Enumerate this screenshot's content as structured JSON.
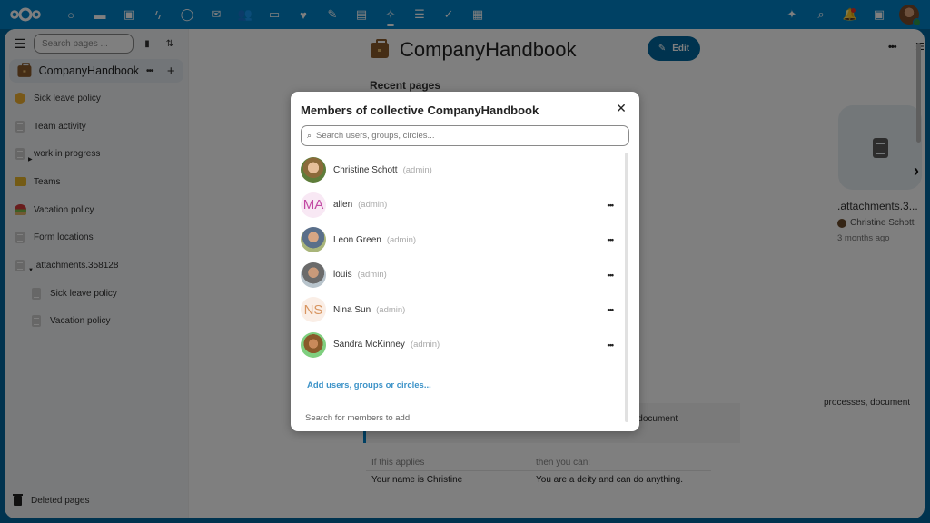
{
  "topbar": {
    "apps": [
      {
        "name": "dashboard",
        "glyph": "○"
      },
      {
        "name": "files",
        "glyph": "▬"
      },
      {
        "name": "photos",
        "glyph": "▣"
      },
      {
        "name": "activity",
        "glyph": "ϟ"
      },
      {
        "name": "talk",
        "glyph": "◯"
      },
      {
        "name": "mail",
        "glyph": "✉"
      },
      {
        "name": "contacts",
        "glyph": "👥"
      },
      {
        "name": "calendar",
        "glyph": "▭"
      },
      {
        "name": "favorites",
        "glyph": "♥"
      },
      {
        "name": "notes",
        "glyph": "✎"
      },
      {
        "name": "deck",
        "glyph": "▤"
      },
      {
        "name": "collectives",
        "glyph": "✧"
      },
      {
        "name": "tasks",
        "glyph": "☰"
      },
      {
        "name": "check",
        "glyph": "✓"
      },
      {
        "name": "tables",
        "glyph": "▦"
      }
    ],
    "right": [
      {
        "name": "assistant",
        "glyph": "✦"
      },
      {
        "name": "search",
        "glyph": "⌕"
      },
      {
        "name": "notifications",
        "glyph": "🔔"
      },
      {
        "name": "contacts-menu",
        "glyph": "▣"
      }
    ]
  },
  "sidebar": {
    "search_placeholder": "Search pages ...",
    "collective_title": "CompanyHandbook",
    "more": "•••",
    "add": "+",
    "pages": [
      {
        "label": "Sick leave policy",
        "icon": "emoji-face",
        "level": 0
      },
      {
        "label": "Team activity",
        "icon": "document",
        "level": 0
      },
      {
        "label": "work in progress",
        "icon": "document",
        "level": 0,
        "collapsed": true
      },
      {
        "label": "Teams",
        "icon": "folder",
        "level": 0
      },
      {
        "label": "Vacation policy",
        "icon": "emoji-beach",
        "level": 0
      },
      {
        "label": "Form locations",
        "icon": "document",
        "level": 0
      },
      {
        "label": ".attachments.358128",
        "icon": "document",
        "level": 0,
        "expanded": true
      },
      {
        "label": "Sick leave policy",
        "icon": "document",
        "level": 1
      },
      {
        "label": "Vacation policy",
        "icon": "document",
        "level": 1
      }
    ],
    "deleted_label": "Deleted pages"
  },
  "main": {
    "title": "CompanyHandbook",
    "edit_label": "Edit",
    "more": "•••",
    "recent_title": "Recent pages",
    "recent_card": {
      "name": ".attachments.3...",
      "author": "Christine Schott",
      "date": "3 months ago"
    },
    "body_text": "processes, document",
    "callout": "How to know if you are cool enough to be allowed to edit this document",
    "table": {
      "headers": [
        "If this applies",
        "then you can!"
      ],
      "rows": [
        [
          "Your name is Christine",
          "You are a deity and can do anything."
        ]
      ]
    }
  },
  "modal": {
    "title": "Members of collective CompanyHandbook",
    "search_placeholder": "Search users, groups, circles...",
    "members": [
      {
        "name": "Christine Schott",
        "role": "(admin)",
        "avatar": "photo1",
        "initials": "",
        "has_menu": false
      },
      {
        "name": "allen",
        "role": "(admin)",
        "avatar": "initials-ma",
        "initials": "MA",
        "has_menu": true
      },
      {
        "name": "Leon Green",
        "role": "(admin)",
        "avatar": "photo2",
        "initials": "",
        "has_menu": true
      },
      {
        "name": "louis",
        "role": "(admin)",
        "avatar": "photo3",
        "initials": "",
        "has_menu": true
      },
      {
        "name": "Nina Sun",
        "role": "(admin)",
        "avatar": "initials-ns",
        "initials": "NS",
        "has_menu": true
      },
      {
        "name": "Sandra McKinney",
        "role": "(admin)",
        "avatar": "photo4",
        "initials": "",
        "has_menu": true
      }
    ],
    "menu_glyph": "•••",
    "add_link": "Add users, groups or circles...",
    "hint": "Search for members to add",
    "close_glyph": "✕"
  },
  "colors": {
    "header": "#0082c9",
    "primary": "#00679e",
    "link": "#3d93c8"
  }
}
